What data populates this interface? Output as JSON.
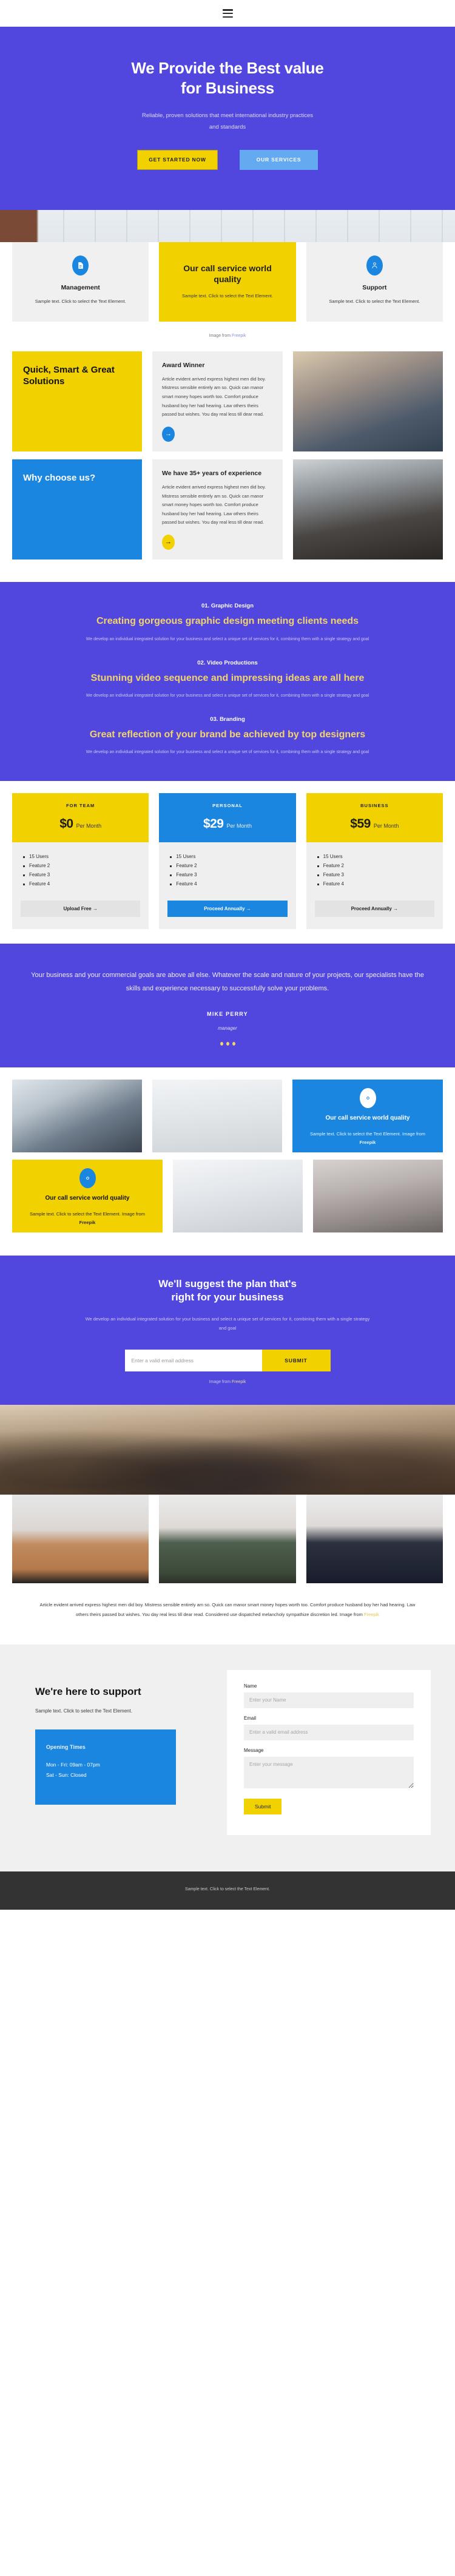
{
  "nav": {
    "menu_icon": "hamburger-menu-icon"
  },
  "hero": {
    "title_line1": "We Provide the Best value",
    "title_line2": "for Business",
    "subtitle": "Reliable, proven solutions that meet international industry practices and standards",
    "primary_button": "GET STARTED NOW",
    "secondary_button": "OUR SERVICES"
  },
  "features": {
    "cards": [
      {
        "icon": "document-icon",
        "title": "Management",
        "text": "Sample text. Click to select the Text Element.",
        "accent": false
      },
      {
        "icon": "none",
        "title": "Our call service world quality",
        "text": "Sample text. Click to select the Text Element.",
        "accent": true
      },
      {
        "icon": "user-icon",
        "title": "Support",
        "text": "Sample text. Click to select the Text Element.",
        "accent": false
      }
    ],
    "credit_prefix": "Image from ",
    "credit_link": "Freepik"
  },
  "splits": [
    {
      "heading": "Quick, Smart & Great Solutions",
      "panel_color": "#f2d100",
      "card_title": "Award Winner",
      "card_text": "Article evident arrived express highest men did boy. Mistress sensible entirely am so. Quick can manor smart money hopes worth too. Comfort produce husband boy her had hearing. Law others theirs passed but wishes. You day real less till dear read.",
      "arrow": "arrow-right-icon",
      "arrow_color": "#1a86e0"
    },
    {
      "heading": "Why choose us?",
      "panel_color": "#1a86e0",
      "card_title": "We have 35+ years of experience",
      "card_text": "Article evident arrived express highest men did boy. Mistress sensible entirely am so. Quick can manor smart money hopes worth too. Comfort produce husband boy her had hearing. Law others theirs passed but wishes. You day real less till dear read.",
      "arrow": "arrow-right-icon",
      "arrow_color": "#f2d100"
    }
  ],
  "services": {
    "items": [
      {
        "number": "01. Graphic Design",
        "title": "Creating gorgeous graphic design meeting clients needs",
        "text": "We develop an individual integrated solution for your business and select a unique set of services for it, combining them with a single strategy and goal"
      },
      {
        "number": "02. Video Productions",
        "title": "Stunning video sequence and impressing ideas are all here",
        "text": "We develop an individual integrated solution for your business and select a unique set of services for it, combining them with a single strategy and goal"
      },
      {
        "number": "03. Branding",
        "title": "Great reflection of your brand be achieved by top designers",
        "text": "We develop an individual integrated solution for your business and select a unique set of services for it, combining them with a single strategy and goal"
      }
    ]
  },
  "pricing": {
    "plans": [
      {
        "name": "FOR TEAM",
        "amount": "$0",
        "period": "Per Month",
        "features": [
          "15 Users",
          "Feature 2",
          "Feature 3",
          "Feature 4"
        ],
        "button": "Upload Free →",
        "highlight": false
      },
      {
        "name": "PERSONAL",
        "amount": "$29",
        "period": "Per Month",
        "features": [
          "15 Users",
          "Feature 2",
          "Feature 3",
          "Feature 4"
        ],
        "button": "Proceed Annually →",
        "highlight": true
      },
      {
        "name": "BUSINESS",
        "amount": "$59",
        "period": "Per Month",
        "features": [
          "15 Users",
          "Feature 2",
          "Feature 3",
          "Feature 4"
        ],
        "button": "Proceed Annually →",
        "highlight": false
      }
    ]
  },
  "testimonial": {
    "quote": "Your business and your commercial goals are above all else. Whatever the scale and nature of your projects, our specialists have the skills and experience necessary to successfully solve your problems.",
    "name": "MIKE PERRY",
    "role": "manager",
    "dots": 3
  },
  "gallery": {
    "blue_tile": {
      "icon": "gear-icon",
      "title": "Our call service world quality",
      "text": "Sample text. Click to select the Text Element. Image from ",
      "text_bold": "Freepik"
    },
    "yellow_tile": {
      "icon": "gear-icon",
      "title": "Our call service world quality",
      "text": "Sample text. Click to select the Text Element. Image from ",
      "text_bold": "Freepik"
    }
  },
  "cta": {
    "title_line1": "We'll suggest the plan that's",
    "title_line2": "right for your business",
    "text": "We develop an individual integrated solution for your business and select a unique set of services for it, combining them with a single strategy and goal",
    "email_placeholder": "Enter a valid email address",
    "submit_label": "SUBMIT",
    "credit_prefix": "Image from ",
    "credit_link": "Freepik"
  },
  "team_article": {
    "text": "Article evident arrived express highest men did boy. Mistress sensible entirely am so. Quick can manor smart money hopes worth too. Comfort produce husband boy her had hearing. Law others theirs passed but wishes. You day real less till dear read. Considered use dispatched melancholy sympathize discretion led. Image from ",
    "link": "Freepik"
  },
  "support": {
    "title": "We're here to support",
    "text": "Sample text. Click to select the Text Element.",
    "hours_title": "Opening Times",
    "hours_weekday": "Mon - Fri: 09am - 07pm",
    "hours_weekend": "Sat - Sun: Closed",
    "form": {
      "name_label": "Name",
      "name_placeholder": "Enter your Name",
      "email_label": "Email",
      "email_placeholder": "Enter a valid email address",
      "message_label": "Message",
      "message_placeholder": "Enter your message",
      "submit_label": "Submit"
    }
  },
  "footer": {
    "text": "Sample text. Click to select the Text Element."
  },
  "colors": {
    "purple": "#5146dd",
    "yellow": "#f2d100",
    "blue": "#1a86e0",
    "light_blue": "#63aaf0",
    "grey": "#efefef",
    "dark": "#333333"
  }
}
